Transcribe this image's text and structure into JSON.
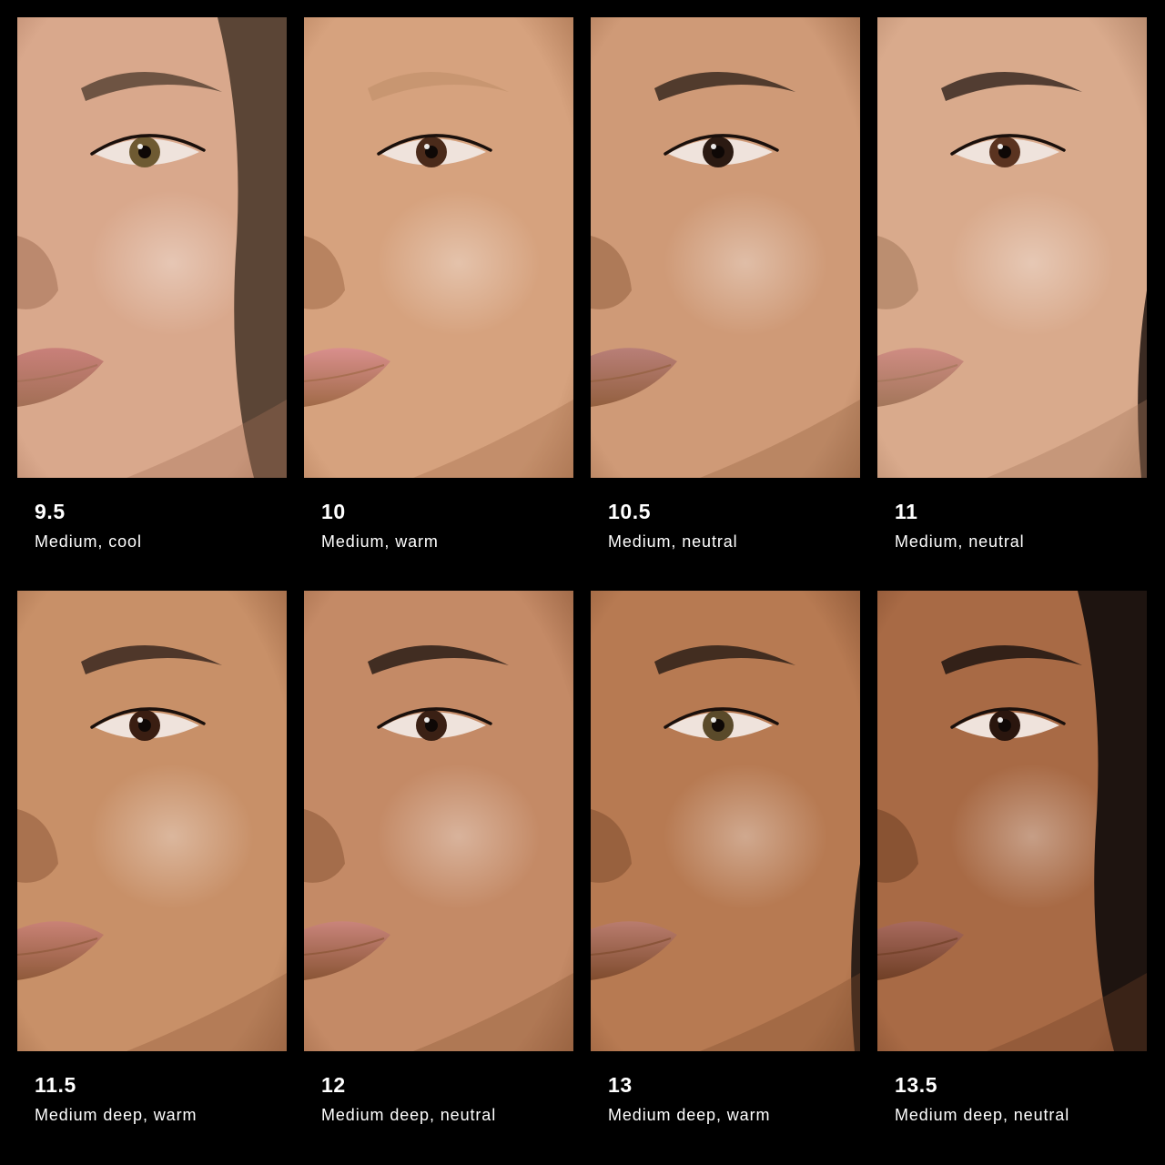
{
  "swatches": [
    {
      "shade": "9.5",
      "description": "Medium, cool",
      "skin": "#d9a88c",
      "skin_dark": "#a26f55",
      "lip": "#c9807a",
      "hair": "#5b4536",
      "iris": "#6e5a32"
    },
    {
      "shade": "10",
      "description": "Medium, warm",
      "skin": "#d6a27e",
      "skin_dark": "#a06a47",
      "lip": "#d98f8d",
      "hair": "#c6946e",
      "iris": "#4a2a1a"
    },
    {
      "shade": "10.5",
      "description": "Medium, neutral",
      "skin": "#cf9a77",
      "skin_dark": "#93603f",
      "lip": "#b97f78",
      "hair": "#3b2a20",
      "iris": "#2b1a12"
    },
    {
      "shade": "11",
      "description": "Medium, neutral",
      "skin": "#d9aa8c",
      "skin_dark": "#a3765a",
      "lip": "#cf8c83",
      "hair": "#3a2a22",
      "iris": "#5a3320"
    },
    {
      "shade": "11.5",
      "description": "Medium deep, warm",
      "skin": "#c89068",
      "skin_dark": "#8f5a3a",
      "lip": "#c98276",
      "hair": "#3a2820",
      "iris": "#3a1e12"
    },
    {
      "shade": "12",
      "description": "Medium deep, neutral",
      "skin": "#c48a66",
      "skin_dark": "#8a5535",
      "lip": "#c9847b",
      "hair": "#2a1c16",
      "iris": "#3a2014"
    },
    {
      "shade": "13",
      "description": "Medium deep, warm",
      "skin": "#b77a52",
      "skin_dark": "#7f4c2e",
      "lip": "#b97c6e",
      "hair": "#2e2018",
      "iris": "#5a4a2a"
    },
    {
      "shade": "13.5",
      "description": "Medium deep, neutral",
      "skin": "#a86a45",
      "skin_dark": "#6f3f25",
      "lip": "#a86a5e",
      "hair": "#1e1410",
      "iris": "#2a160e"
    }
  ]
}
